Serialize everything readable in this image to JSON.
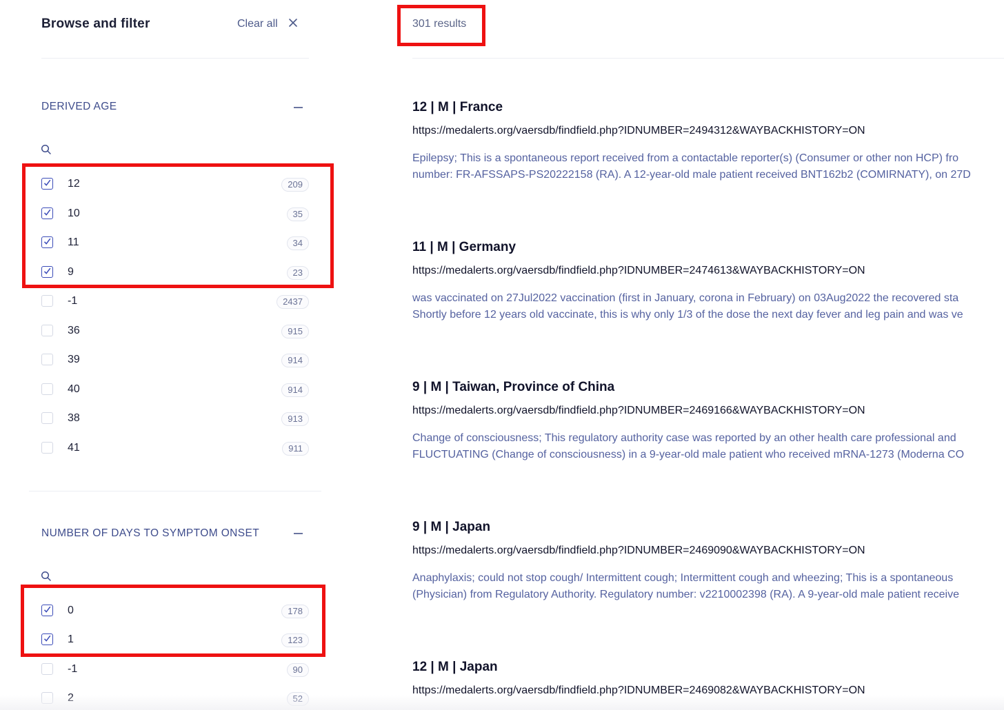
{
  "sidebar": {
    "title": "Browse and filter",
    "clear_all": "Clear all",
    "sections": [
      {
        "title": "DERIVED AGE",
        "items": [
          {
            "label": "12",
            "count": "209",
            "checked": true
          },
          {
            "label": "10",
            "count": "35",
            "checked": true
          },
          {
            "label": "11",
            "count": "34",
            "checked": true
          },
          {
            "label": "9",
            "count": "23",
            "checked": true
          },
          {
            "label": "-1",
            "count": "2437",
            "checked": false
          },
          {
            "label": "36",
            "count": "915",
            "checked": false
          },
          {
            "label": "39",
            "count": "914",
            "checked": false
          },
          {
            "label": "40",
            "count": "914",
            "checked": false
          },
          {
            "label": "38",
            "count": "913",
            "checked": false
          },
          {
            "label": "41",
            "count": "911",
            "checked": false
          }
        ]
      },
      {
        "title": "NUMBER OF DAYS TO SYMPTOM ONSET",
        "items": [
          {
            "label": "0",
            "count": "178",
            "checked": true
          },
          {
            "label": "1",
            "count": "123",
            "checked": true
          },
          {
            "label": "-1",
            "count": "90",
            "checked": false
          },
          {
            "label": "2",
            "count": "52",
            "checked": false
          }
        ]
      }
    ]
  },
  "results": {
    "count_label": "301 results",
    "items": [
      {
        "title": "12 | M | France",
        "url": "https://medalerts.org/vaersdb/findfield.php?IDNUMBER=2494312&WAYBACKHISTORY=ON",
        "desc1": "Epilepsy; This is a spontaneous report received from a contactable reporter(s) (Consumer or other non HCP) fro",
        "desc2": "number: FR-AFSSAPS-PS20222158 (RA). A 12-year-old male patient received BNT162b2 (COMIRNATY), on 27D"
      },
      {
        "title": "11 | M | Germany",
        "url": "https://medalerts.org/vaersdb/findfield.php?IDNUMBER=2474613&WAYBACKHISTORY=ON",
        "desc1": "was vaccinated on 27Jul2022 vaccination (first in January, corona in February) on 03Aug2022 the recovered sta",
        "desc2": "Shortly before 12 years old vaccinate, this is why only 1/3 of the dose the next day fever and leg pain and was ve"
      },
      {
        "title": "9 | M | Taiwan, Province of China",
        "url": "https://medalerts.org/vaersdb/findfield.php?IDNUMBER=2469166&WAYBACKHISTORY=ON",
        "desc1": "Change of consciousness; This regulatory authority case was reported by an other health care professional and",
        "desc2": "FLUCTUATING (Change of consciousness) in a 9-year-old male patient who received mRNA-1273 (Moderna CO"
      },
      {
        "title": "9 | M | Japan",
        "url": "https://medalerts.org/vaersdb/findfield.php?IDNUMBER=2469090&WAYBACKHISTORY=ON",
        "desc1": "Anaphylaxis; could not stop cough/ Intermittent cough; Intermittent cough and wheezing; This is a spontaneous",
        "desc2": "(Physician) from Regulatory Authority. Regulatory number: v2210002398 (RA). A 9-year-old male patient receive"
      },
      {
        "title": "12 | M | Japan",
        "url": "https://medalerts.org/vaersdb/findfield.php?IDNUMBER=2469082&WAYBACKHISTORY=ON",
        "desc1": "",
        "desc2": ""
      }
    ]
  },
  "colors": {
    "accent": "#3e4c8c",
    "highlight": "#ee1111",
    "checkbox_checked": "#3a4bb8"
  }
}
